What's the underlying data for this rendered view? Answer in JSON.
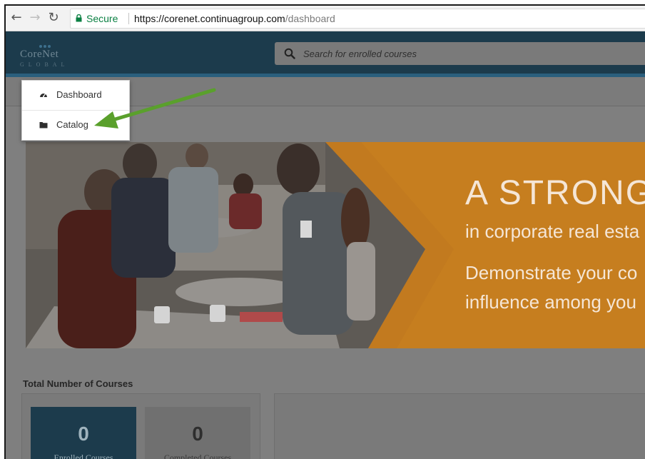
{
  "browser": {
    "back_icon": "back-arrow-icon",
    "forward_icon": "forward-arrow-icon",
    "reload_icon": "reload-icon",
    "security_label": "Secure",
    "url_host": "https://corenet.continuagroup.com",
    "url_path": "/dashboard"
  },
  "header": {
    "logo_main": "CoreNet",
    "logo_sub": "GLOBAL",
    "search_placeholder": "Search for enrolled courses"
  },
  "menu": {
    "items": [
      {
        "label": "Dashboard",
        "icon": "dashboard-gauge-icon"
      },
      {
        "label": "Catalog",
        "icon": "folder-icon"
      }
    ]
  },
  "hero": {
    "line1": "A STRONG",
    "line2": "in corporate real esta",
    "line3": "Demonstrate your co",
    "line4": "influence among you"
  },
  "stats": {
    "title": "Total Number of Courses",
    "enrolled": {
      "value": "0",
      "label": "Enrolled Courses"
    },
    "completed": {
      "value": "0",
      "label": "Completed Courses"
    }
  },
  "colors": {
    "header_navy": "#1c3b4c",
    "hero_orange": "#c27a1f",
    "annotation_arrow": "#5aa02c",
    "secure_green": "#0b8043"
  }
}
